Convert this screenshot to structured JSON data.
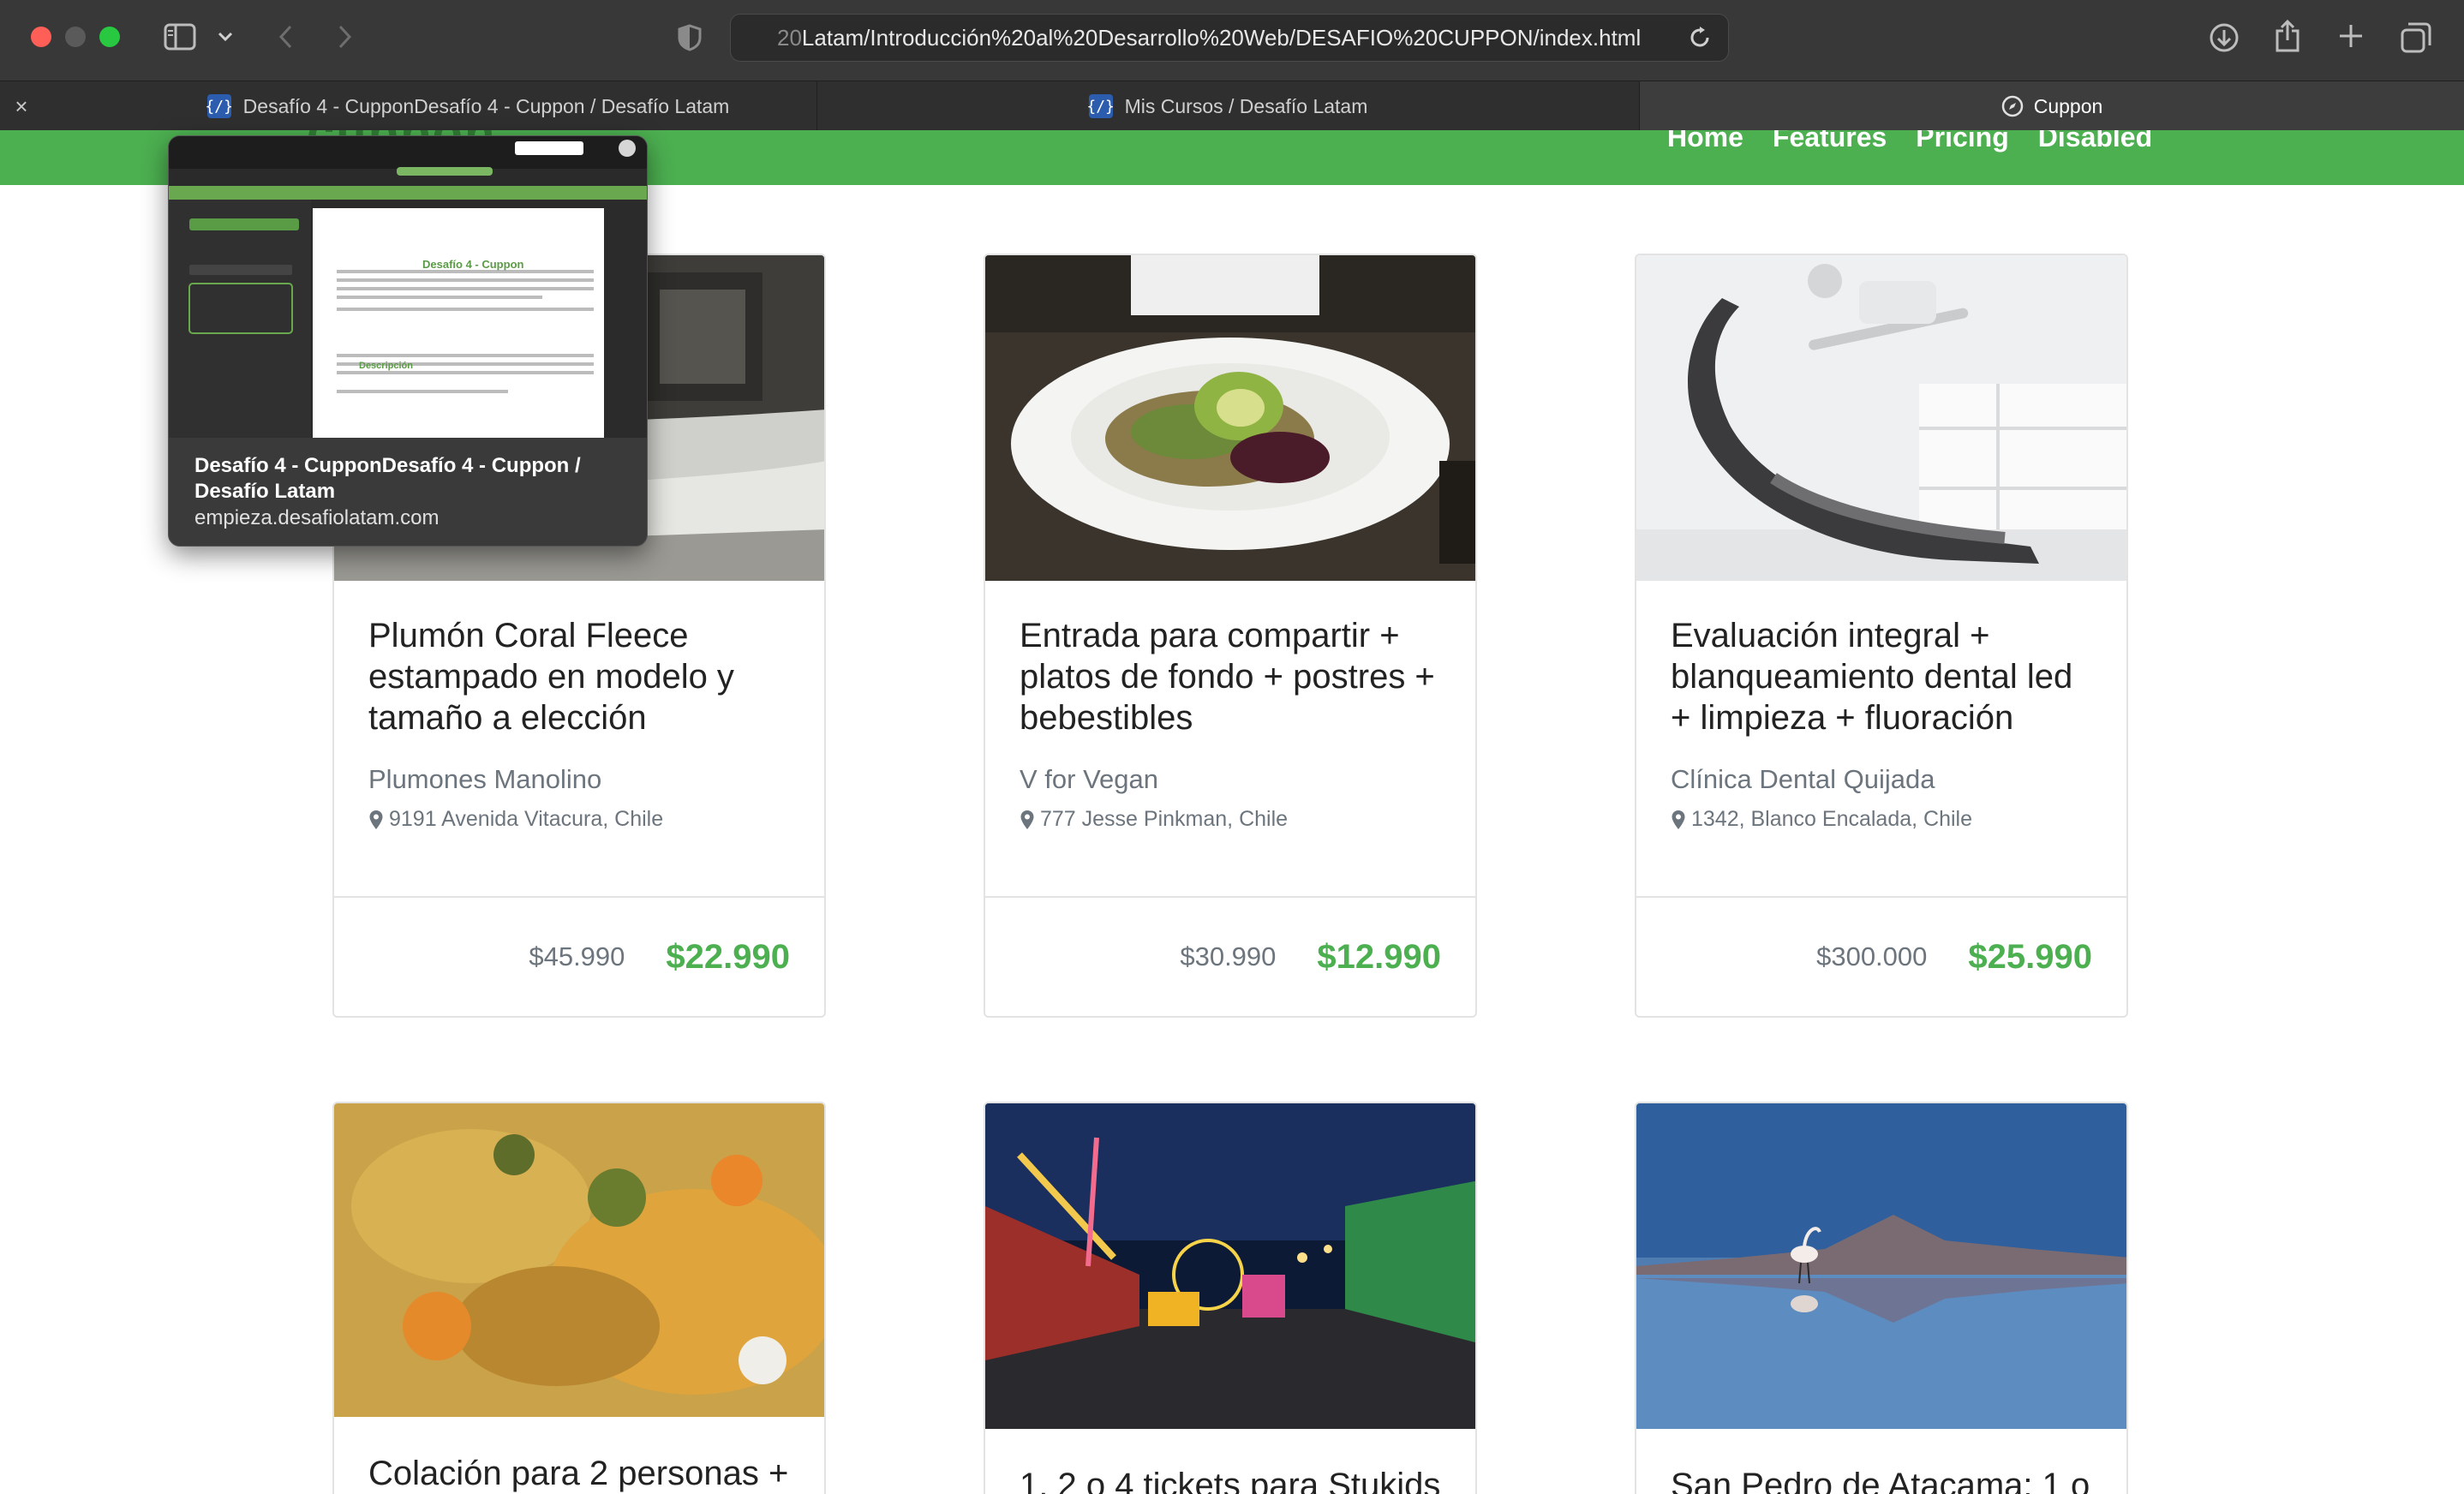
{
  "browser": {
    "url_faded": "20",
    "url_main": "Latam/Introducción%20al%20Desarrollo%20Web/DESAFIO%20CUPPON/index.html",
    "tabs": [
      {
        "label": "Desafío 4 - CupponDesafío 4 - Cuppon / Desafío Latam",
        "favicon": "{/}"
      },
      {
        "label": "Mis Cursos / Desafío Latam",
        "favicon": "{/}"
      },
      {
        "label": "Cuppon"
      }
    ]
  },
  "preview": {
    "title": "Desafío 4 - CupponDesafío 4 - Cuppon / Desafío Latam",
    "url": "empieza.desafiolatam.com",
    "thumb_heading": "Desafío 4 - Cuppon",
    "thumb_section": "Descripción"
  },
  "site": {
    "brand": "cuppon",
    "nav": [
      "Home",
      "Features",
      "Pricing",
      "Disabled"
    ],
    "accent": "#4caf50"
  },
  "cards": [
    {
      "title": "Plumón Coral Fleece estampado en modelo y tamaño a elección",
      "seller": "Plumones Manolino",
      "location": "9191 Avenida Vitacura, Chile",
      "old_price": "$45.990",
      "new_price": "$22.990"
    },
    {
      "title": "Entrada para compartir + platos de fondo + postres + bebestibles",
      "seller": "V for Vegan",
      "location": "777 Jesse Pinkman, Chile",
      "old_price": "$30.990",
      "new_price": "$12.990"
    },
    {
      "title": "Evaluación integral + blanqueamiento dental led + limpieza + fluoración",
      "seller": "Clínica Dental Quijada",
      "location": "1342, Blanco Encalada, Chile",
      "old_price": "$300.000",
      "new_price": "$25.990"
    },
    {
      "title": "Colación para 2 personas +"
    },
    {
      "title": "1, 2 o 4 tickets para Stukids"
    },
    {
      "title": "San Pedro de Atacama: 1 o"
    }
  ]
}
